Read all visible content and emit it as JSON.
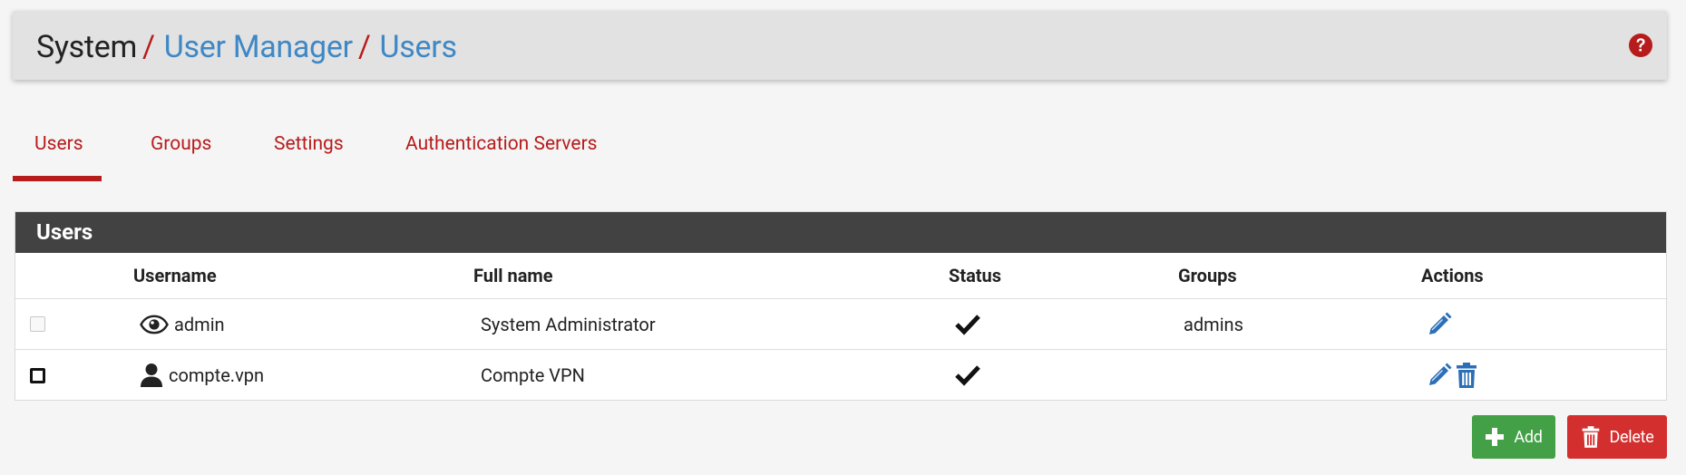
{
  "breadcrumb": {
    "root": "System",
    "sep1": "/",
    "link1": "User Manager",
    "sep2": "/",
    "link2": "Users"
  },
  "tabs": [
    {
      "label": "Users",
      "active": true
    },
    {
      "label": "Groups",
      "active": false
    },
    {
      "label": "Settings",
      "active": false
    },
    {
      "label": "Authentication Servers",
      "active": false
    }
  ],
  "panel": {
    "title": "Users",
    "columns": {
      "username": "Username",
      "full_name": "Full name",
      "status": "Status",
      "groups": "Groups",
      "actions": "Actions"
    },
    "rows": [
      {
        "username": "admin",
        "user_icon": "eye-icon",
        "full_name": "System Administrator",
        "status_icon": "checkmark-icon",
        "groups": "admins",
        "selectable": false,
        "actions": [
          "edit-icon"
        ]
      },
      {
        "username": "compte.vpn",
        "user_icon": "user-icon",
        "full_name": "Compte VPN",
        "status_icon": "checkmark-icon",
        "groups": "",
        "selectable": true,
        "actions": [
          "edit-icon",
          "trash-icon"
        ]
      }
    ]
  },
  "buttons": {
    "add_label": "Add",
    "delete_label": "Delete"
  },
  "colors": {
    "accent_red": "#b71c1c",
    "link_blue": "#3f88c5",
    "panel_heading": "#424242",
    "add_green": "#43a047",
    "delete_red": "#d32f2f",
    "edit_blue": "#2c6fb7"
  }
}
